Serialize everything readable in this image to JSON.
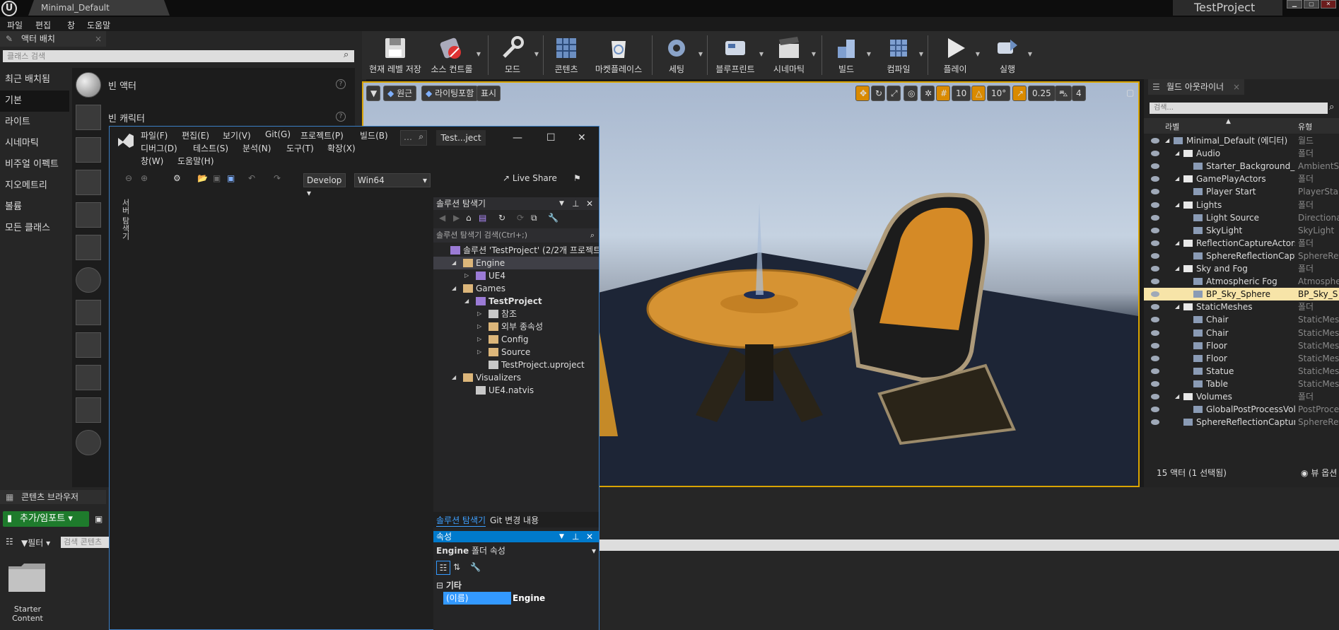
{
  "ue": {
    "doc_tab": "Minimal_Default",
    "project_tab": "TestProject",
    "menu": [
      "파일",
      "편집",
      "창",
      "도움말"
    ],
    "place_panel": {
      "title": "액터 배치",
      "search_placeholder": "클래스 검색",
      "categories": [
        "최근 배치됨",
        "기본",
        "라이트",
        "시네마틱",
        "비주얼 이펙트",
        "지오메트리",
        "볼륨",
        "모든 클래스"
      ],
      "selected_category": "기본",
      "actors": [
        "빈 액터",
        "빈 캐릭터"
      ]
    },
    "toolbar": [
      "현재 레벨 저장",
      "소스 컨트롤",
      "모드",
      "콘텐츠",
      "마켓플레이스",
      "세팅",
      "블루프린트",
      "시네마틱",
      "빌드",
      "컴파일",
      "플레이",
      "실행"
    ],
    "viewport": {
      "perspective": "원근",
      "view_mode": "라이팅포함",
      "show": "표시",
      "grid_snap": "10",
      "rotation_snap": "10°",
      "scale_snap": "0.25",
      "camera_speed": "4"
    },
    "outliner": {
      "title": "월드 아웃라이너",
      "search_placeholder": "검색...",
      "col_label": "라벨",
      "col_type": "유형",
      "rows": [
        {
          "label": "Minimal_Default (에디터)",
          "type": "월드",
          "indent": 0,
          "selected": false
        },
        {
          "label": "Audio",
          "type": "폴더",
          "indent": 1,
          "selected": false
        },
        {
          "label": "Starter_Background_Cu",
          "type": "AmbientSo",
          "indent": 2,
          "selected": false
        },
        {
          "label": "GamePlayActors",
          "type": "폴더",
          "indent": 1,
          "selected": false
        },
        {
          "label": "Player Start",
          "type": "PlayerStart",
          "indent": 2,
          "selected": false
        },
        {
          "label": "Lights",
          "type": "폴더",
          "indent": 1,
          "selected": false
        },
        {
          "label": "Light Source",
          "type": "Directional",
          "indent": 2,
          "selected": false
        },
        {
          "label": "SkyLight",
          "type": "SkyLight",
          "indent": 2,
          "selected": false
        },
        {
          "label": "ReflectionCaptureActors",
          "type": "폴더",
          "indent": 1,
          "selected": false
        },
        {
          "label": "SphereReflectionCaptu",
          "type": "SphereRefl",
          "indent": 2,
          "selected": false
        },
        {
          "label": "Sky and Fog",
          "type": "폴더",
          "indent": 1,
          "selected": false
        },
        {
          "label": "Atmospheric Fog",
          "type": "Atmospher",
          "indent": 2,
          "selected": false
        },
        {
          "label": "BP_Sky_Sphere",
          "type": "BP_Sky_S",
          "indent": 2,
          "selected": true
        },
        {
          "label": "StaticMeshes",
          "type": "폴더",
          "indent": 1,
          "selected": false
        },
        {
          "label": "Chair",
          "type": "StaticMesh",
          "indent": 2,
          "selected": false
        },
        {
          "label": "Chair",
          "type": "StaticMesh",
          "indent": 2,
          "selected": false
        },
        {
          "label": "Floor",
          "type": "StaticMesh",
          "indent": 2,
          "selected": false
        },
        {
          "label": "Floor",
          "type": "StaticMesh",
          "indent": 2,
          "selected": false
        },
        {
          "label": "Statue",
          "type": "StaticMesh",
          "indent": 2,
          "selected": false
        },
        {
          "label": "Table",
          "type": "StaticMesh",
          "indent": 2,
          "selected": false
        },
        {
          "label": "Volumes",
          "type": "폴더",
          "indent": 1,
          "selected": false
        },
        {
          "label": "GlobalPostProcessVolu",
          "type": "PostProces",
          "indent": 2,
          "selected": false
        },
        {
          "label": "SphereReflectionCapture",
          "type": "SphereRefl",
          "indent": 1,
          "selected": false
        }
      ],
      "status": "15 액터 (1 선택됨)",
      "view_options": "뷰 옵션"
    },
    "content_browser": {
      "title": "콘텐츠 브라우저",
      "add_import": "추가/임포트",
      "filter": "필터",
      "search_placeholder": "검색 콘텐츠",
      "folder_label": "Starter Content"
    }
  },
  "vs": {
    "menu_row1": [
      "파일(F)",
      "편집(E)",
      "보기(V)",
      "Git(G)",
      "프로젝트(P)",
      "빌드(B)"
    ],
    "menu_row2": [
      "디버그(D)",
      "테스트(S)",
      "분석(N)",
      "도구(T)",
      "확장(X)"
    ],
    "menu_row3": [
      "창(W)",
      "도움말(H)"
    ],
    "project_name": "Test...ject",
    "config": "Develop",
    "platform": "Win64",
    "live_share": "Live Share",
    "side_label": "서버 탐색기",
    "solution_explorer": {
      "title": "솔루션 탐색기",
      "search_placeholder": "솔루션 탐색기 검색(Ctrl+;)",
      "rows": [
        {
          "text": "솔루션 'TestProject' (2/2개 프로젝트",
          "indent": 0,
          "arrow": "",
          "bold": false,
          "selected": false
        },
        {
          "text": "Engine",
          "indent": 1,
          "arrow": "◢",
          "bold": false,
          "selected": true
        },
        {
          "text": "UE4",
          "indent": 2,
          "arrow": "▷",
          "bold": false,
          "selected": false
        },
        {
          "text": "Games",
          "indent": 1,
          "arrow": "◢",
          "bold": false,
          "selected": false
        },
        {
          "text": "TestProject",
          "indent": 2,
          "arrow": "◢",
          "bold": true,
          "selected": false
        },
        {
          "text": "참조",
          "indent": 3,
          "arrow": "▷",
          "bold": false,
          "selected": false
        },
        {
          "text": "외부 종속성",
          "indent": 3,
          "arrow": "▷",
          "bold": false,
          "selected": false
        },
        {
          "text": "Config",
          "indent": 3,
          "arrow": "▷",
          "bold": false,
          "selected": false
        },
        {
          "text": "Source",
          "indent": 3,
          "arrow": "▷",
          "bold": false,
          "selected": false
        },
        {
          "text": "TestProject.uproject",
          "indent": 3,
          "arrow": "",
          "bold": false,
          "selected": false
        },
        {
          "text": "Visualizers",
          "indent": 1,
          "arrow": "◢",
          "bold": false,
          "selected": false
        },
        {
          "text": "UE4.natvis",
          "indent": 2,
          "arrow": "",
          "bold": false,
          "selected": false
        }
      ],
      "tab_active": "솔루션 탐색기",
      "tab_git": "Git 변경 내용"
    },
    "properties": {
      "title": "속성",
      "object": "Engine",
      "object_kind": "폴더 속성",
      "category": "기타",
      "name_key": "(이름)",
      "name_value": "Engine"
    }
  },
  "colors": {
    "accent": "#007acc",
    "ue_select": "#d9a400",
    "add_green": "#1e7b2c"
  }
}
